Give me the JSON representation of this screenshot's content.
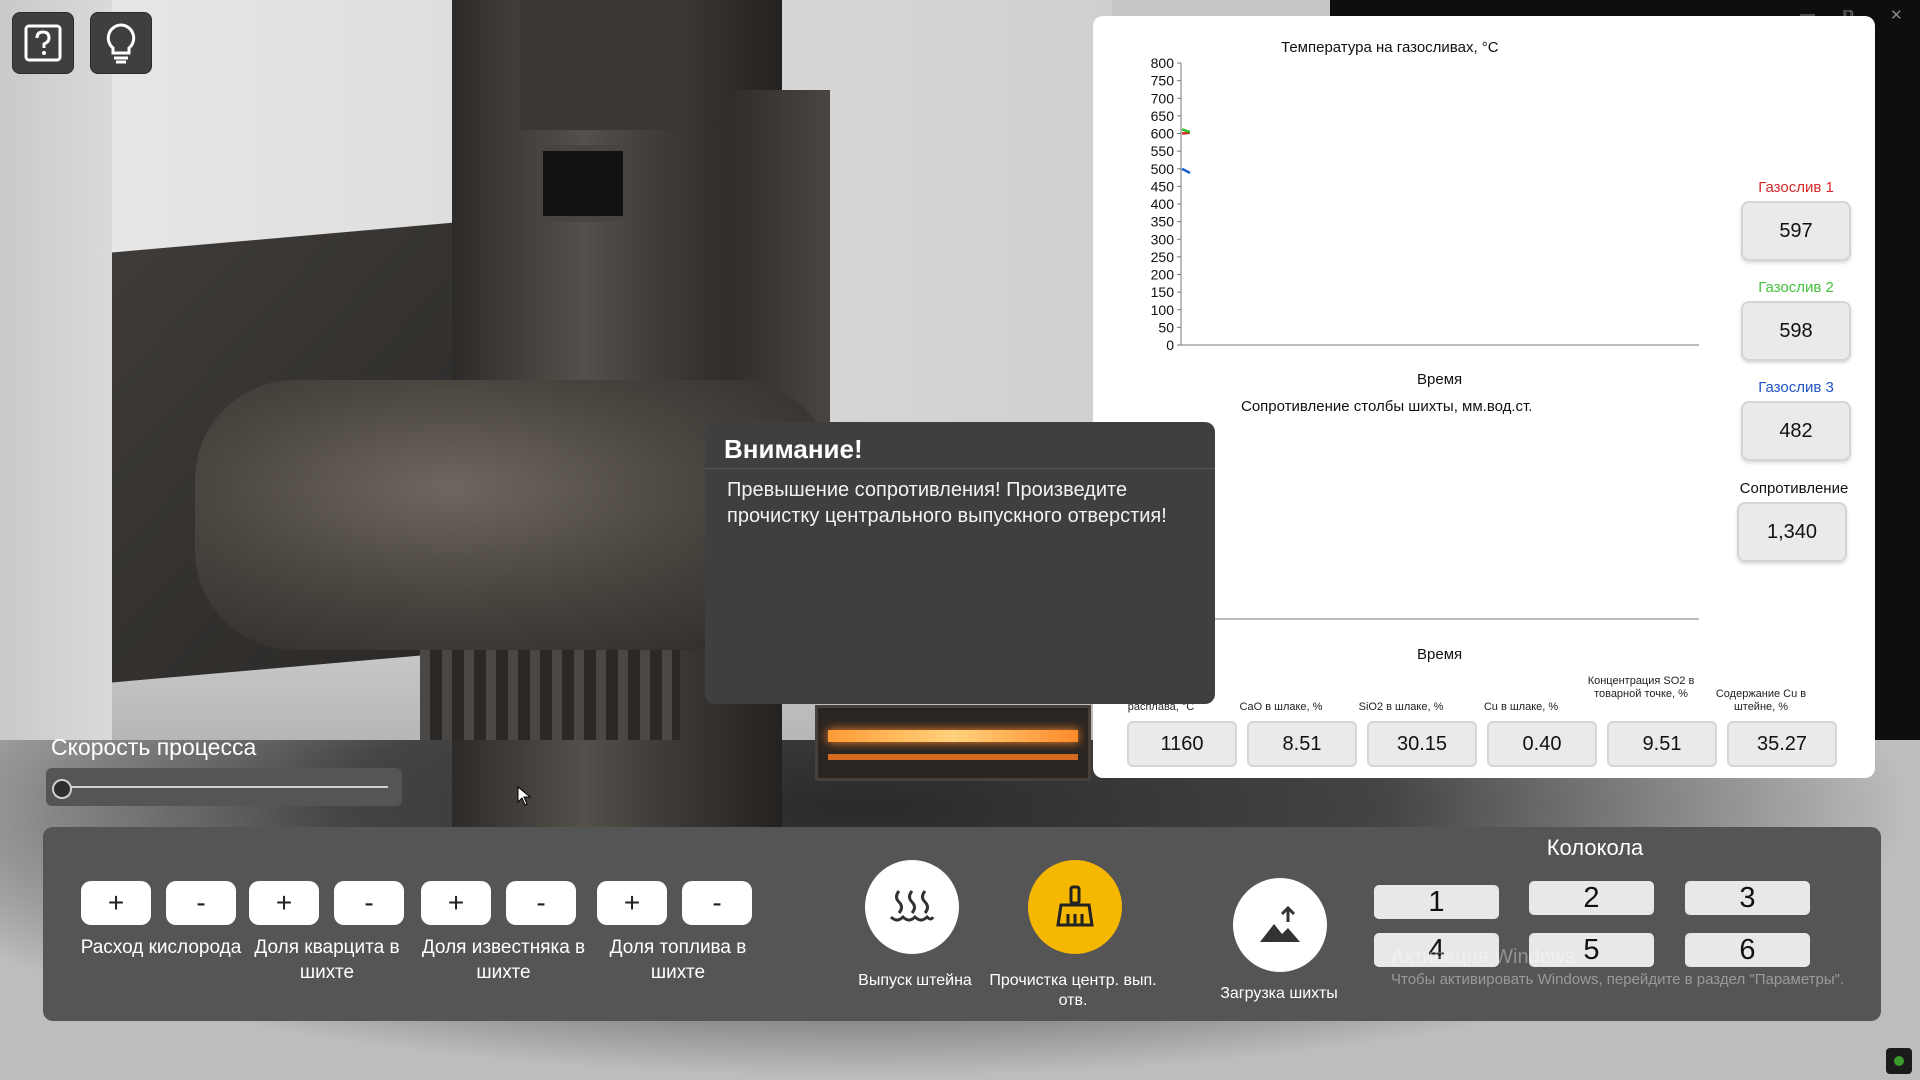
{
  "temp_chart": {
    "title": "Температура на газосливах, °C",
    "xlabel": "Время",
    "y_ticks": [
      "800",
      "750",
      "700",
      "650",
      "600",
      "550",
      "500",
      "450",
      "400",
      "350",
      "300",
      "250",
      "200",
      "150",
      "100",
      "50",
      "0"
    ]
  },
  "resistance_chart": {
    "title": "Сопротивление столбы шихты, мм.вод.ст.",
    "xlabel": "Время"
  },
  "chart_data": [
    {
      "type": "line",
      "title": "Температура на газосливах, °C",
      "xlabel": "Время",
      "ylabel": "",
      "ylim": [
        0,
        800
      ],
      "y_tick_step": 50,
      "series": [
        {
          "name": "Газослив 1",
          "color": "#d42a2a",
          "values": [
            600,
            602
          ]
        },
        {
          "name": "Газослив 2",
          "color": "#2fbf2f",
          "values": [
            612,
            604
          ]
        },
        {
          "name": "Газослив 3",
          "color": "#1f5fcf",
          "values": [
            500,
            488
          ]
        }
      ]
    },
    {
      "type": "line",
      "title": "Сопротивление столбы шихты, мм.вод.ст.",
      "xlabel": "Время",
      "series": []
    }
  ],
  "readouts": {
    "g1": {
      "label": "Газослив 1",
      "value": "597",
      "color": "#d42a2a"
    },
    "g2": {
      "label": "Газослив 2",
      "value": "598",
      "color": "#45c13c"
    },
    "g3": {
      "label": "Газослив 3",
      "value": "482",
      "color": "#2155c4"
    },
    "resistance": {
      "label": "Сопротивление",
      "value": "1,340",
      "color": "#111111"
    }
  },
  "params": [
    {
      "label": "a\nрасплава, °C",
      "value": "1160"
    },
    {
      "label": "CaO в шлаке, %",
      "value": "8.51"
    },
    {
      "label": "SiO2 в шлаке, %",
      "value": "30.15"
    },
    {
      "label": "Cu в шлаке, %",
      "value": "0.40"
    },
    {
      "label": "Концентрация SO2 в товарной точке, %",
      "value": "9.51"
    },
    {
      "label": "Содержание Cu в штейне, %",
      "value": "35.27"
    }
  ],
  "alert": {
    "title": "Внимание!",
    "message": "Превышение сопротивления! Произведите прочистку центрального выпускного отверстия!"
  },
  "speed": {
    "label": "Скорость процесса",
    "value_fraction": 0.0
  },
  "controls": {
    "plus": "+",
    "minus": "-",
    "groups": [
      {
        "label": "Расход кислорода"
      },
      {
        "label": "Доля кварцита в шихте"
      },
      {
        "label": "Доля известняка в шихте"
      },
      {
        "label": "Доля топлива в шихте"
      }
    ],
    "release_label": "Выпуск штейна",
    "clean_label": "Прочистка центр. вып. отв.",
    "load_label": "Загрузка шихты",
    "accent": "#f5b700"
  },
  "bells": {
    "title": "Колокола",
    "items": [
      "1",
      "2",
      "3",
      "4",
      "5",
      "6"
    ]
  },
  "watermark": {
    "line1": "Активация Windows",
    "line2": "Чтобы активировать Windows, перейдите в раздел \"Параметры\"."
  },
  "icons": {
    "help": "help-icon",
    "hint": "lightbulb-icon",
    "release": "steam-icon",
    "clean": "broom-icon",
    "load": "load-mountain-icon"
  }
}
